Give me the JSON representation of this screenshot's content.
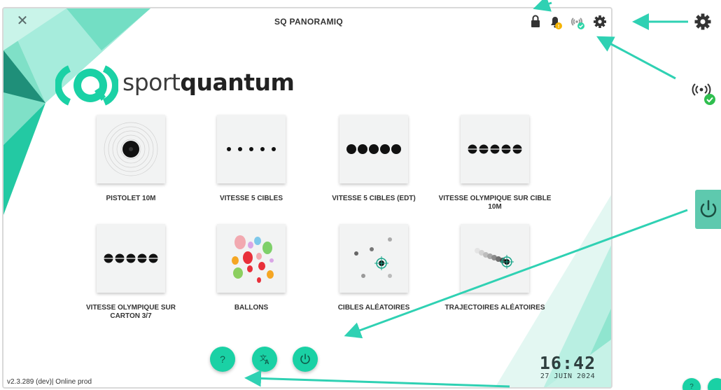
{
  "window": {
    "title": "SQ PANORAMIQ",
    "close_icon": "close-icon",
    "status_icons": [
      "lock-icon",
      "bell-icon",
      "connection-icon",
      "gear-icon"
    ]
  },
  "logo": {
    "text_light": "sport",
    "text_bold": "quantum"
  },
  "exercises": [
    {
      "label": "PISTOLET 10M",
      "icon": "pistol-target-icon"
    },
    {
      "label": "VITESSE 5 CIBLES",
      "icon": "five-small-dots-icon"
    },
    {
      "label": "VITESSE 5 CIBLES (EDT)",
      "icon": "five-large-dots-icon"
    },
    {
      "label": "VITESSE OLYMPIQUE SUR CIBLE 10M",
      "icon": "five-split-dots-icon"
    },
    {
      "label": "VITESSE OLYMPIQUE SUR CARTON 3/7",
      "icon": "five-split-dots-icon"
    },
    {
      "label": "BALLONS",
      "icon": "balloons-icon"
    },
    {
      "label": "CIBLES ALÉATOIRES",
      "icon": "random-targets-icon"
    },
    {
      "label": "TRAJECTOIRES ALÉATOIRES",
      "icon": "random-trajectories-icon"
    }
  ],
  "bottom_buttons": {
    "help_label": "?",
    "translate_icon": "translate-icon",
    "power_icon": "power-icon"
  },
  "clock": {
    "time": "16:42",
    "date": "27 JUIN 2024"
  },
  "footer": {
    "version": "v2.3.289 (dev)| Online prod"
  },
  "annotations": {
    "settings_icon": "gear-icon",
    "connection_icon": "connection-ok-icon",
    "power_icon": "power-icon",
    "mini_help_label": "?",
    "accent_color": "#1ad1a5",
    "arrow_color": "#2fd1b3"
  }
}
